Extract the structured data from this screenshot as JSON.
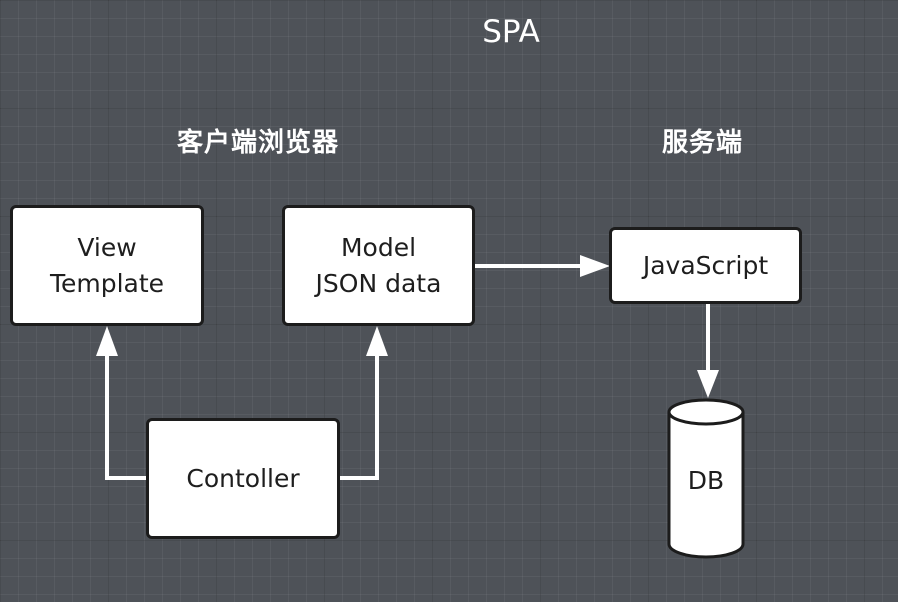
{
  "diagram": {
    "title": "SPA",
    "sections": {
      "client": "客户端浏览器",
      "server": "服务端"
    },
    "nodes": {
      "view": {
        "line1": "View",
        "line2": "Template"
      },
      "model": {
        "line1": "Model",
        "line2": "JSON data"
      },
      "controller": {
        "label": "Contoller"
      },
      "javascript": {
        "label": "JavaScript"
      },
      "db": {
        "label": "DB"
      }
    },
    "edges": [
      {
        "from": "controller",
        "to": "view"
      },
      {
        "from": "controller",
        "to": "model"
      },
      {
        "from": "model",
        "to": "javascript"
      },
      {
        "from": "javascript",
        "to": "db"
      }
    ],
    "colors": {
      "background": "#4e5258",
      "node_fill": "#ffffff",
      "node_border": "#1c1c1c",
      "connector": "#ffffff",
      "label_text": "#ffffff"
    }
  }
}
